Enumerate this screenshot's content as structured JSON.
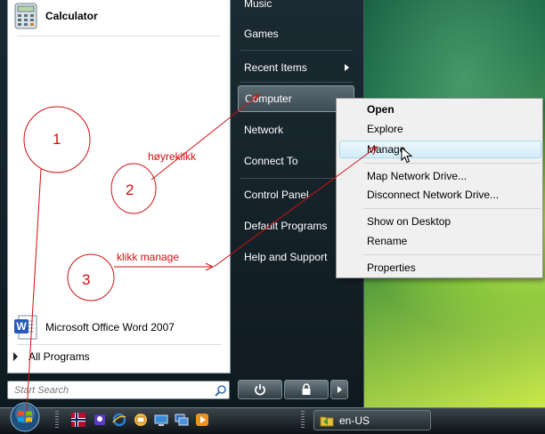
{
  "start_menu": {
    "pinned": [
      {
        "label": "Calculator",
        "icon": "calculator-icon"
      },
      {
        "label": "Microsoft Office Word 2007",
        "icon": "word-icon"
      }
    ],
    "all_programs": "All Programs",
    "search_placeholder": "Start Search",
    "right_items": [
      "Music",
      "Games",
      "Recent Items",
      "Computer",
      "Network",
      "Connect To",
      "Control Panel",
      "Default Programs",
      "Help and Support"
    ]
  },
  "context_menu": {
    "items": [
      "Open",
      "Explore",
      "Manage",
      "Map Network Drive...",
      "Disconnect Network Drive...",
      "Show on Desktop",
      "Rename",
      "Properties"
    ]
  },
  "taskbar": {
    "task_label": "en-US"
  },
  "annotations": {
    "step1": "1",
    "step2": "2",
    "step3": "3",
    "label_right_click": "høyreklikk",
    "label_click_manage": "klikk manage",
    "color": "#d01010"
  }
}
